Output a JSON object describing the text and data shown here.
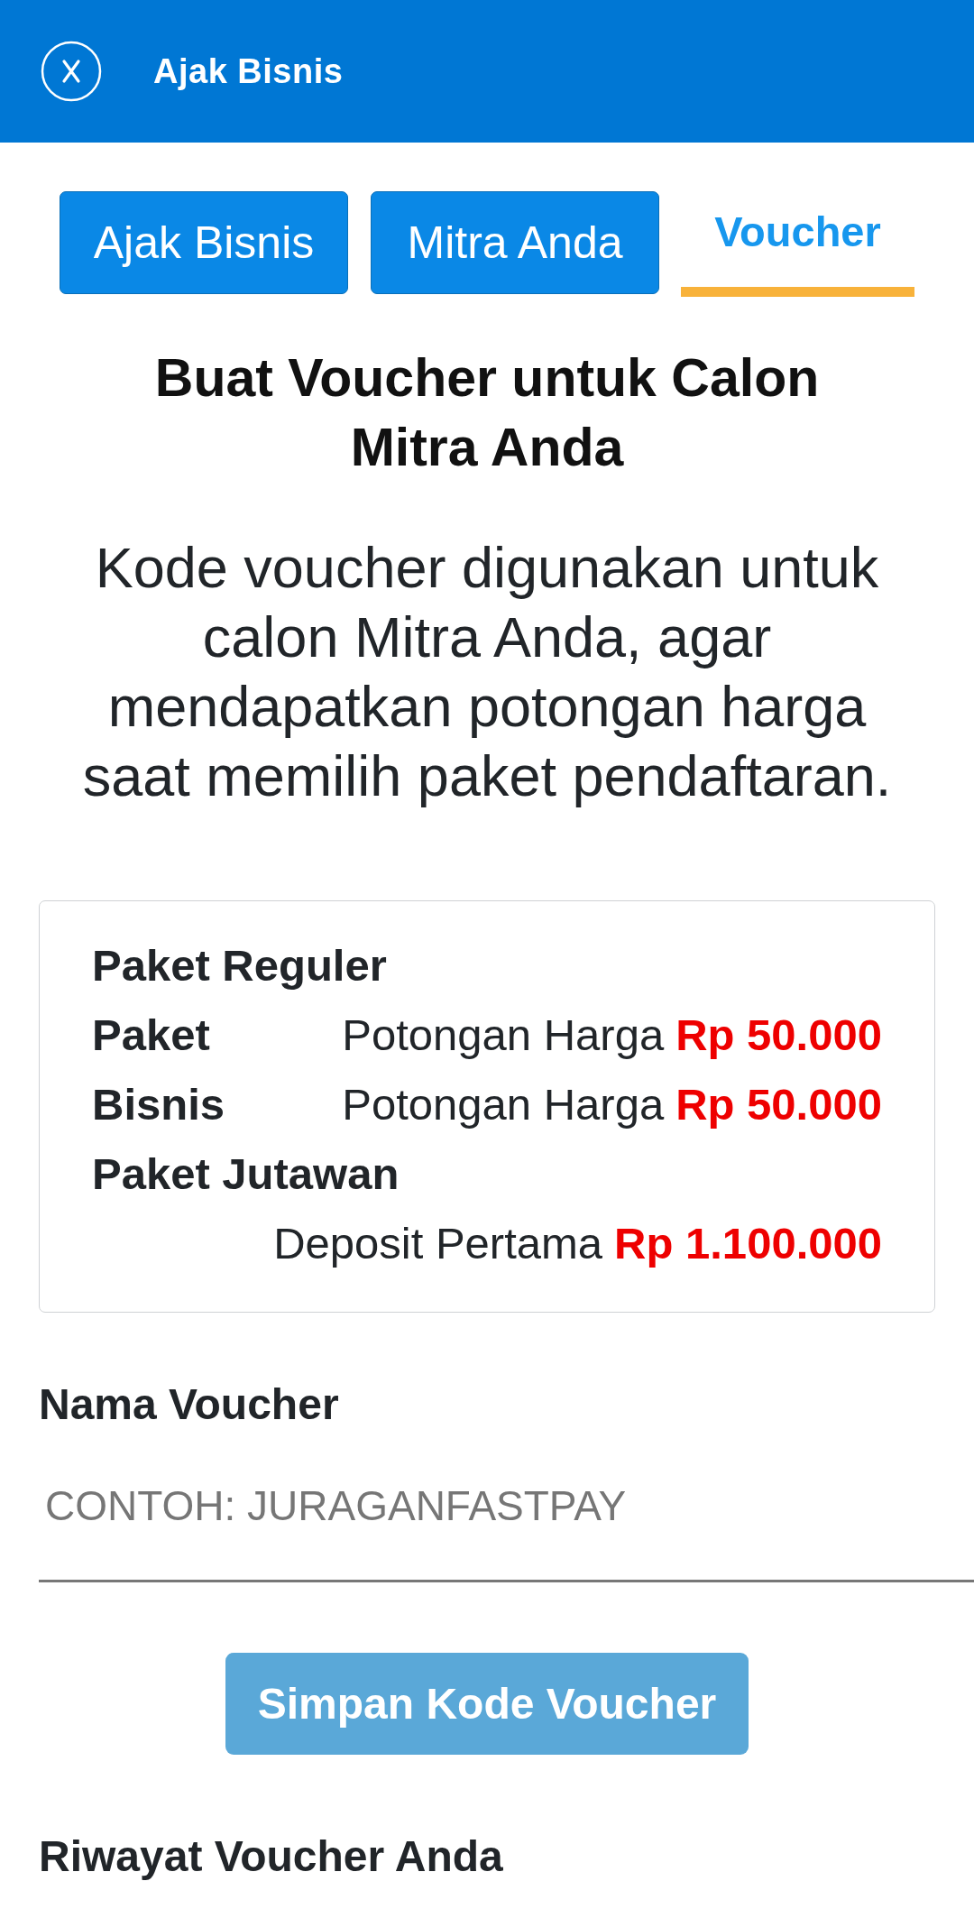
{
  "header": {
    "title": "Ajak Bisnis"
  },
  "tabs": [
    {
      "label": "Ajak Bisnis",
      "selected": false
    },
    {
      "label": "Mitra Anda",
      "selected": false
    },
    {
      "label": "Voucher",
      "selected": true
    }
  ],
  "heading": "Buat Voucher untuk Calon Mitra Anda",
  "description": "Kode voucher digunakan untuk calon Mitra Anda, agar mendapatkan potongan harga saat memilih paket pendaftaran.",
  "offer_card": {
    "lines": [
      {
        "label": "Paket Reguler"
      },
      {
        "label": "Paket",
        "detail": "Potongan Harga",
        "amount": "Rp 50.000"
      },
      {
        "label": "Bisnis",
        "detail": "Potongan Harga",
        "amount": "Rp 50.000"
      },
      {
        "label": "Paket Jutawan"
      },
      {
        "detail": "Deposit Pertama",
        "amount": "Rp 1.100.000"
      }
    ]
  },
  "voucher_form": {
    "label": "Nama Voucher",
    "placeholder": "CONTOH: JURAGANFASTPAY",
    "submit": {
      "label": "Simpan Kode Voucher",
      "disabled": true
    }
  },
  "history": {
    "title": "Riwayat Voucher Anda"
  }
}
